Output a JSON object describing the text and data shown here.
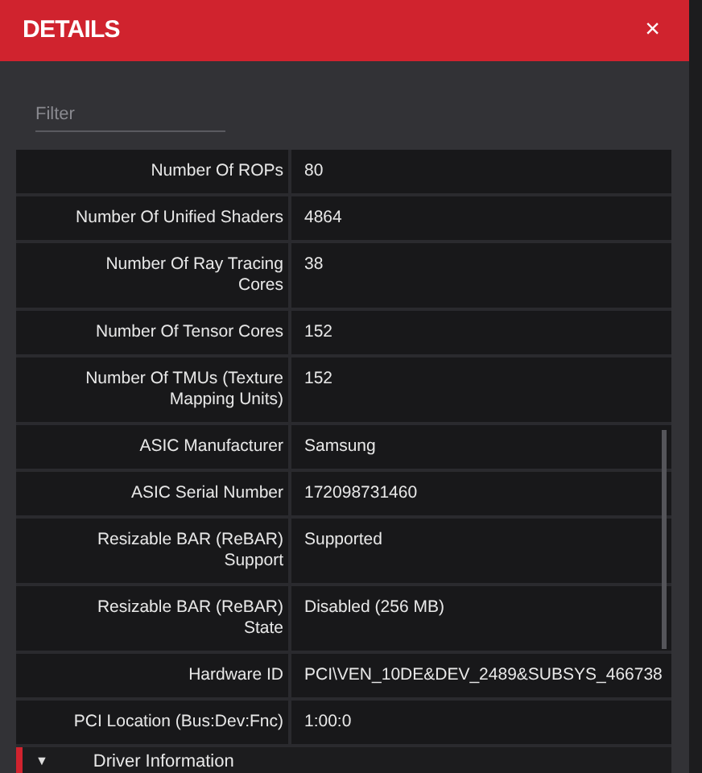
{
  "window": {
    "title": "DETAILS",
    "close": "×"
  },
  "filter": {
    "placeholder": "Filter"
  },
  "rows": [
    {
      "label": "Number Of ROPs",
      "value": "80"
    },
    {
      "label": "Number Of Unified Shaders",
      "value": "4864"
    },
    {
      "label": "Number Of Ray Tracing Cores",
      "value": "38"
    },
    {
      "label": "Number Of Tensor Cores",
      "value": "152"
    },
    {
      "label": "Number Of TMUs (Texture Mapping Units)",
      "value": "152"
    },
    {
      "label": "ASIC Manufacturer",
      "value": "Samsung"
    },
    {
      "label": "ASIC Serial Number",
      "value": "172098731460"
    },
    {
      "label": "Resizable BAR (ReBAR) Support",
      "value": "Supported"
    },
    {
      "label": "Resizable BAR (ReBAR) State",
      "value": "Disabled (256 MB)"
    },
    {
      "label": "Hardware ID",
      "value": "PCI\\VEN_10DE&DEV_2489&SUBSYS_466738"
    },
    {
      "label": "PCI Location (Bus:Dev:Fnc)",
      "value": "1:00:0"
    }
  ],
  "section": {
    "toggle": "▼",
    "label": "Driver Information",
    "expanded": true
  }
}
